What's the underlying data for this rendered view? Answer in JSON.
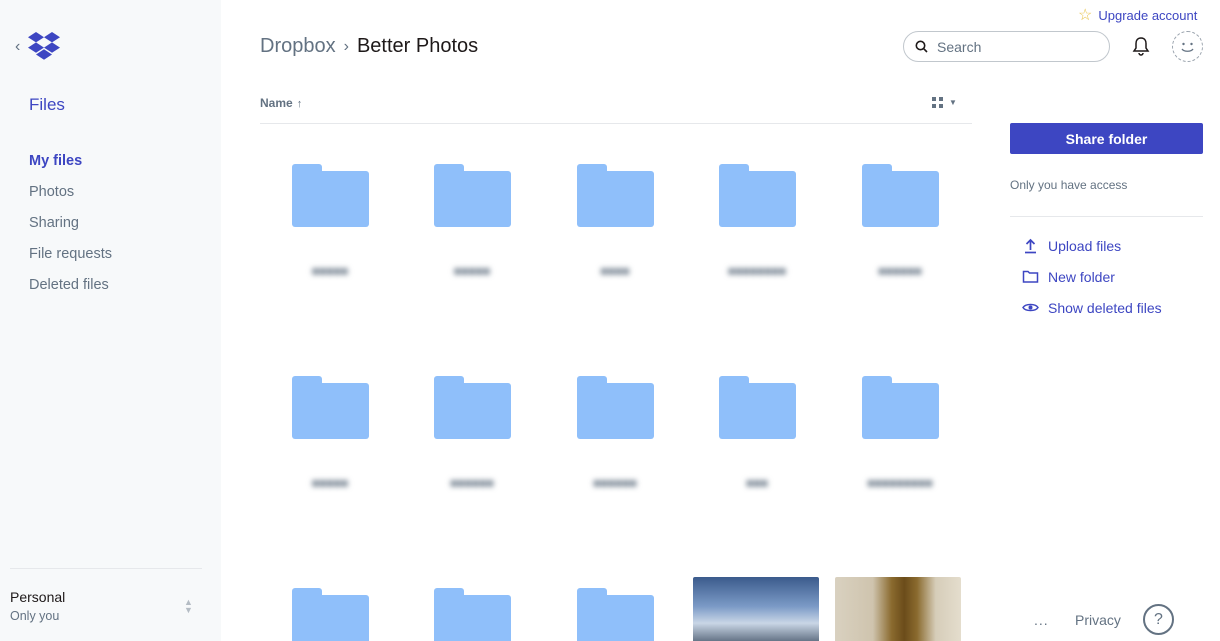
{
  "upgrade": {
    "label": "Upgrade account"
  },
  "sidebar": {
    "title": "Files",
    "items": [
      {
        "label": "My files",
        "active": true
      },
      {
        "label": "Photos"
      },
      {
        "label": "Sharing"
      },
      {
        "label": "File requests"
      },
      {
        "label": "Deleted files"
      }
    ],
    "account": {
      "name": "Personal",
      "sub": "Only you"
    }
  },
  "breadcrumb": {
    "root": "Dropbox",
    "current": "Better Photos"
  },
  "search": {
    "placeholder": "Search"
  },
  "list": {
    "column_name": "Name",
    "folders": [
      {
        "label": "■■■■■"
      },
      {
        "label": "■■■■■"
      },
      {
        "label": "■■■■"
      },
      {
        "label": "■■■■■■■■"
      },
      {
        "label": "■■■■■■"
      },
      {
        "label": "■■■■■"
      },
      {
        "label": "■■■■■■"
      },
      {
        "label": "■■■■■■"
      },
      {
        "label": "■■■"
      },
      {
        "label": "■■■■■■■■■"
      },
      {
        "label": ""
      },
      {
        "label": ""
      },
      {
        "label": ""
      }
    ]
  },
  "panel": {
    "share_label": "Share folder",
    "access_text": "Only you have access",
    "actions": [
      {
        "label": "Upload files",
        "icon": "upload-icon"
      },
      {
        "label": "New folder",
        "icon": "folder-icon"
      },
      {
        "label": "Show deleted files",
        "icon": "eye-icon"
      }
    ]
  },
  "footer": {
    "more": "...",
    "privacy": "Privacy",
    "help": "?"
  },
  "colors": {
    "accent": "#3d46c2",
    "folder": "#8fbffa",
    "sidebar_bg": "#f7f9fa"
  }
}
